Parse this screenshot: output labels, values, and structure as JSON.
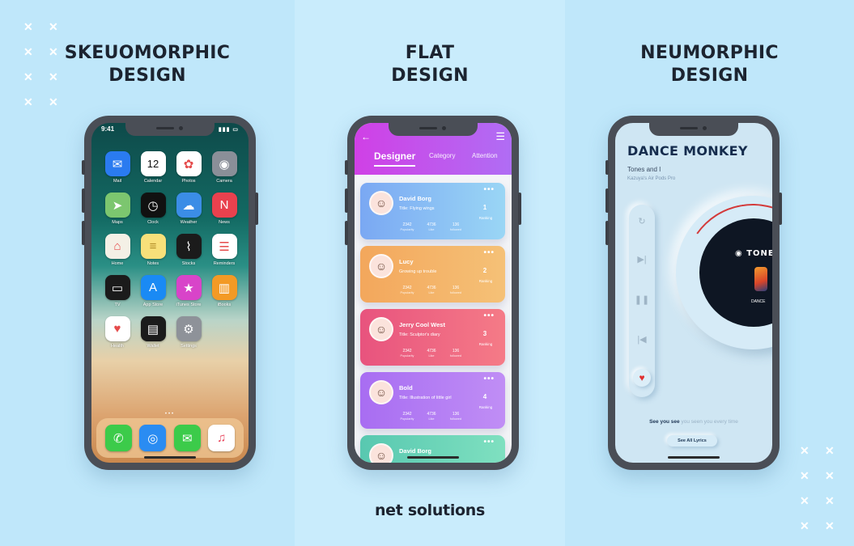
{
  "columns": [
    {
      "title_line1": "SKEUOMORPHIC",
      "title_line2": "DESIGN"
    },
    {
      "title_line1": "FLAT",
      "title_line2": "DESIGN"
    },
    {
      "title_line1": "NEUMORPHIC",
      "title_line2": "DESIGN"
    }
  ],
  "skeuomorphic": {
    "time": "9:41",
    "apps": [
      {
        "label": "Mail",
        "icon": "mail-icon",
        "glyph": "✉",
        "color": "#2a7bf0"
      },
      {
        "label": "Calendar",
        "icon": "calendar-icon",
        "glyph": "12",
        "color": "#ffffff"
      },
      {
        "label": "Photos",
        "icon": "photos-icon",
        "glyph": "✿",
        "color": "#ffffff"
      },
      {
        "label": "Camera",
        "icon": "camera-icon",
        "glyph": "◉",
        "color": "#8a8f98"
      },
      {
        "label": "Maps",
        "icon": "maps-icon",
        "glyph": "➤",
        "color": "#7cc66f"
      },
      {
        "label": "Clock",
        "icon": "clock-icon",
        "glyph": "◷",
        "color": "#111111"
      },
      {
        "label": "Weather",
        "icon": "weather-icon",
        "glyph": "☁",
        "color": "#3b8de6"
      },
      {
        "label": "News",
        "icon": "news-icon",
        "glyph": "N",
        "color": "#e9414e"
      },
      {
        "label": "Home",
        "icon": "home-icon",
        "glyph": "⌂",
        "color": "#f4f0e6"
      },
      {
        "label": "Notes",
        "icon": "notes-icon",
        "glyph": "≡",
        "color": "#f8e07a"
      },
      {
        "label": "Stocks",
        "icon": "stocks-icon",
        "glyph": "⌇",
        "color": "#1b1b1b"
      },
      {
        "label": "Reminders",
        "icon": "reminders-icon",
        "glyph": "☰",
        "color": "#ffffff"
      },
      {
        "label": "TV",
        "icon": "tv-icon",
        "glyph": "▭",
        "color": "#1b1b1b"
      },
      {
        "label": "App Store",
        "icon": "app-store-icon",
        "glyph": "A",
        "color": "#1a8af4"
      },
      {
        "label": "iTunes Store",
        "icon": "itunes-store-icon",
        "glyph": "★",
        "color": "#d844c9"
      },
      {
        "label": "iBooks",
        "icon": "ibooks-icon",
        "glyph": "▥",
        "color": "#f39a25"
      },
      {
        "label": "Health",
        "icon": "health-icon",
        "glyph": "♥",
        "color": "#ffffff"
      },
      {
        "label": "Wallet",
        "icon": "wallet-icon",
        "glyph": "▤",
        "color": "#1b1b1b"
      },
      {
        "label": "Settings",
        "icon": "settings-icon",
        "glyph": "⚙",
        "color": "#8e9299"
      }
    ],
    "dock": [
      {
        "icon": "phone-icon",
        "glyph": "✆",
        "color": "#3ccb4a"
      },
      {
        "icon": "safari-icon",
        "glyph": "◎",
        "color": "#2a8cf2"
      },
      {
        "icon": "messages-icon",
        "glyph": "✉",
        "color": "#3ccb4a"
      },
      {
        "icon": "music-icon",
        "glyph": "♫",
        "color": "#ffffff"
      }
    ]
  },
  "flat": {
    "tabs": [
      "Designer",
      "Category",
      "Attention"
    ],
    "stat_labels": [
      "Popularity",
      "Like",
      "followed"
    ],
    "rank_label": "Ranking",
    "cards": [
      {
        "name": "David Borg",
        "subtitle": "Title: Flying wings",
        "rank": "1",
        "stats": [
          "2342",
          "4736",
          "136"
        ],
        "colors": [
          "#7aa8f3",
          "#9ad6f5"
        ]
      },
      {
        "name": "Lucy",
        "subtitle": "Growing up trouble",
        "rank": "2",
        "stats": [
          "2342",
          "4736",
          "136"
        ],
        "colors": [
          "#f3a75c",
          "#f5c177"
        ]
      },
      {
        "name": "Jerry Cool West",
        "subtitle": "Title: Sculptor's diary",
        "rank": "3",
        "stats": [
          "2342",
          "4736",
          "136"
        ],
        "colors": [
          "#e8537e",
          "#f57b87"
        ]
      },
      {
        "name": "Bold",
        "subtitle": "Title: Illustration of little girl",
        "rank": "4",
        "stats": [
          "2342",
          "4736",
          "136"
        ],
        "colors": [
          "#a86df2",
          "#c08ef5"
        ]
      },
      {
        "name": "David Borg",
        "subtitle": "",
        "rank": "",
        "stats": [],
        "colors": [
          "#58c8b0",
          "#7fe0c0"
        ]
      }
    ]
  },
  "neumorphic": {
    "song_title": "DANCE MONKEY",
    "artist": "Tones and I",
    "device": "Kazuya's Air Pods Pro",
    "disc_label": "TONE",
    "disc_sub": "DANCE",
    "lyric_bold": "See you see",
    "lyric_rest": " you seen you every time",
    "lyrics_button": "See All Lyrics"
  },
  "brand": "net solutions"
}
